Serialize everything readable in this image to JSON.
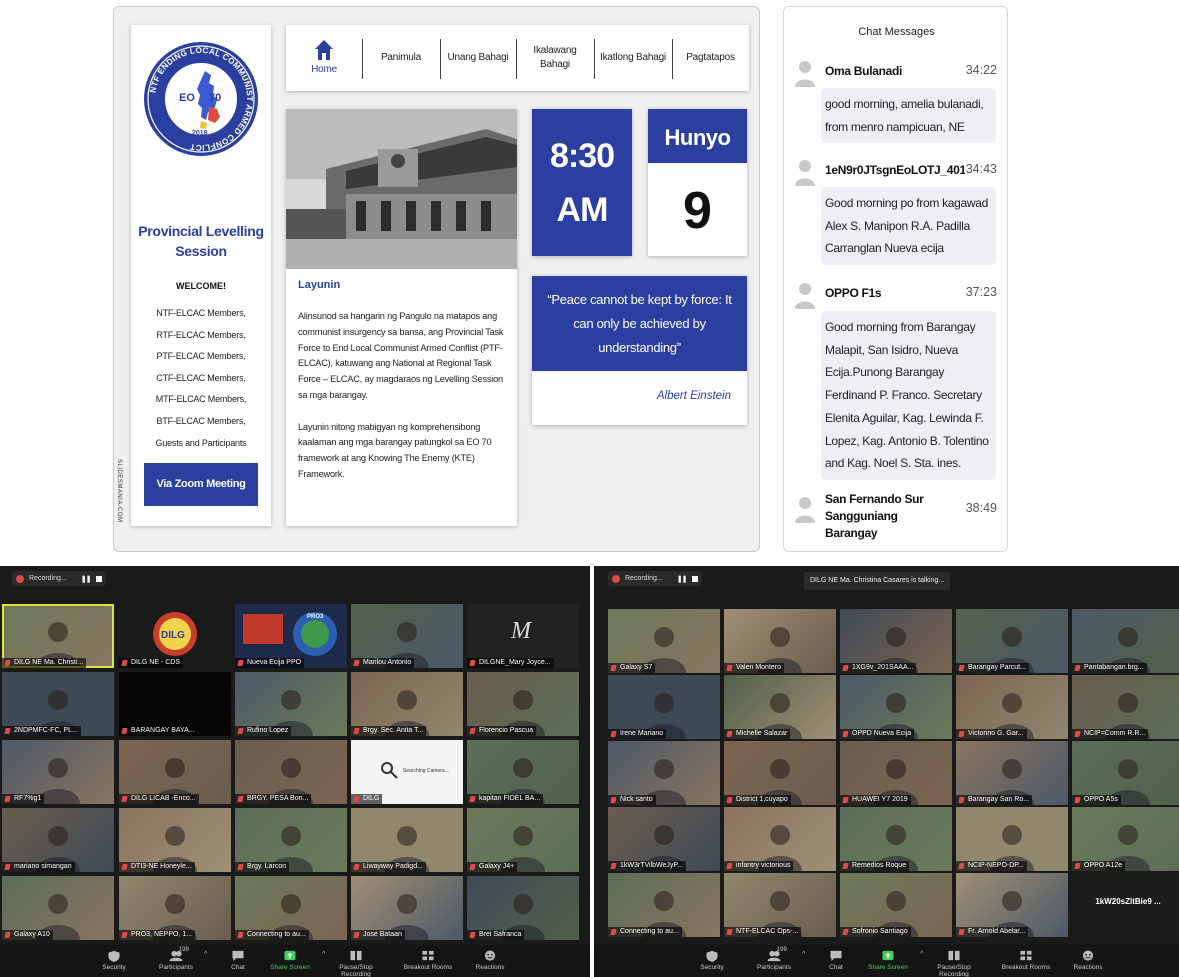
{
  "slide": {
    "logo": {
      "ring_text": "NTF ENDING LOCAL COMMUNIST ARMED CONFLICT",
      "eo": "EO",
      "num": "70",
      "year": "2018"
    },
    "session_title_line1": "Provincial Levelling",
    "session_title_line2": "Session",
    "welcome": "WELCOME!",
    "members": [
      "NTF-ELCAC Members,",
      "RTF-ELCAC Members,",
      "PTF-ELCAC Members,",
      "CTF-ELCAC Members,",
      "MTF-ELCAC Members,",
      "BTF-ELCAC Members,",
      "Guests and Participants"
    ],
    "zoom_button": "Via Zoom Meeting",
    "side_watermark": "SLIDESMANIA.COM",
    "nav": {
      "home": "Home",
      "items": [
        "Panimula",
        "Unang Bahagi",
        "Ikalawang Bahagi",
        "Ikatlong Bahagi",
        "Pagtatapos"
      ]
    },
    "layunin_title": "Layunin",
    "layunin_p1": "Alinsunod sa hangarin ng Pangulo na matapos ang communist insurgency sa bansa, ang Provincial Task Force to End Local Communist Armed Conflist (PTF-ELCAC), katuwang ang National at Regional Task Force – ELCAC, ay magdaraos ng Levelling Session sa mga barangay.",
    "layunin_p2": "Layunin nitong mabigyan ng komprehensibong kaalaman ang mga barangay patungkol sa EO 70 framework at ang Knowing The Enemy (KTE) Framework.",
    "time_line1": "8:30",
    "time_line2": "AM",
    "month": "Hunyo",
    "day": "9",
    "quote": "“Peace cannot be kept by force: It can only be achieved by understanding”",
    "quote_author": "Albert Einstein"
  },
  "chat": {
    "title": "Chat Messages",
    "messages": [
      {
        "name": "Oma Bulanadi",
        "time": "34:22",
        "text": "good morning, amelia bulanadi, from menro nampicuan, NE"
      },
      {
        "name": "1eN9r0JTsgnEoLOTJ_401S...",
        "time": "34:43",
        "text": "Good morning po from kagawad Alex S. Manipon R.A. Padilla Carranglan Nueva ecija"
      },
      {
        "name": "OPPO F1s",
        "time": "37:23",
        "text": "Good morning from Barangay Malapit, San Isidro, Nueva Ecija.Punong Barangay Ferdinand P. Franco. Secretary Elenita Aguilar, Kag. Lewinda F. Lopez, Kag. Antonio B. Tolentino and Kag. Noel S. Sta. ines."
      },
      {
        "name": "San Fernando Sur Sangguniang Barangay",
        "time": "38:49",
        "text": ""
      }
    ]
  },
  "zoomA": {
    "recording": "Recording...",
    "tiles": [
      "DILG NE Ma. Christi...",
      "DILG NE - CDS",
      "Nueva Ecija PPO",
      "Marilou Antonio",
      "DILGNE_Mary Joyce...",
      "2NDPMFC-FC, PL...",
      "BARANGAY BAYA...",
      "Rufino Lopez",
      "Brgy. Sec. Anita T...",
      "Florencio Pascua",
      "RF7%g1",
      "DILG LICAB -Enco...",
      "BRGY. PESA Bon...",
      "DILG",
      "kapitan FIDEL BA...",
      "mariano simangan",
      "DTI3-NE Honeyle...",
      "Brgy. Larcon",
      "Liwayway Padigd...",
      "Galaxy J4+",
      "Galaxy A10",
      "PRO3, NEPPO, 1...",
      "Connecting to au...",
      "Jose Bataan",
      "Brei Safranca"
    ],
    "searching_camera": "Searching Camera...",
    "dilg_logo_text": "DILG",
    "pro3_text": "PRO3",
    "toolbar": {
      "security": "Security",
      "participants": "Participants",
      "participant_count": "199",
      "chat": "Chat",
      "share": "Share Screen",
      "record": "Pause/Stop Recording",
      "breakout": "Breakout Rooms",
      "reactions": "Reactions"
    }
  },
  "zoomB": {
    "recording": "Recording...",
    "talking": "DILG NE Ma. Christina Casares is talking...",
    "tiles": [
      "Galaxy S7",
      "Valen Montero",
      "1XG9v_201SAAA...",
      "Barangay Parcut...",
      "Pantabangan.brg...",
      "Irene Mariano",
      "Michelle Salazar",
      "OPPD Nueva Ecija",
      "Victorino G. Gar...",
      "NCIP=Comm R.R...",
      "Nick santo",
      "District 1,cuyapo",
      "HUAWEI Y7 2019",
      "Barangay San Ro...",
      "OPPO A5s",
      "1kW3rTVilbWeJyP...",
      "infantry victorious",
      "Remedios Roque",
      "NCIP-NEPO-DP...",
      "OPPO A12e",
      "Connecting to au...",
      "NTF-ELCAC Ops-...",
      "Sofronio Santiago",
      "Fr. Arnold Abelar...",
      "1kW20sZltBie9 ..."
    ],
    "toolbar": {
      "security": "Security",
      "participants": "Participants",
      "participant_count": "199",
      "chat": "Chat",
      "share": "Share Screen",
      "record": "Pause/Stop Recording",
      "breakout": "Breakout Rooms",
      "reactions": "Reactions"
    }
  },
  "colors": {
    "brand_blue": "#2a3fa0",
    "zoom_bg": "#1a1a1a",
    "active_speaker": "#d9e53a",
    "share_green": "#3fcf5a"
  }
}
